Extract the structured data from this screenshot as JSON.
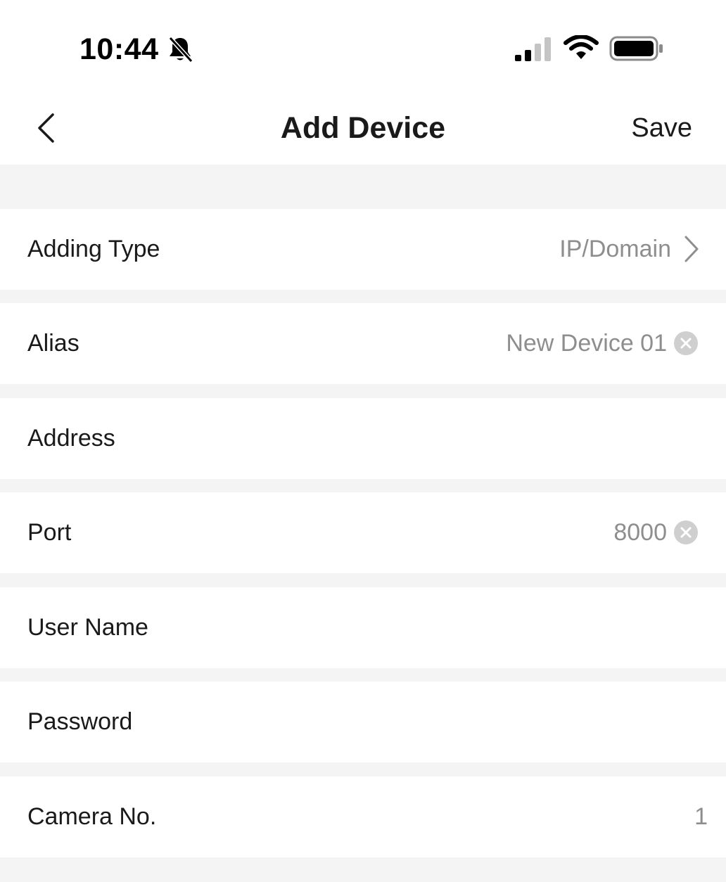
{
  "status_bar": {
    "time": "10:44",
    "icons": [
      "bell-slash-icon",
      "cellular-signal-icon",
      "wifi-icon",
      "battery-icon"
    ]
  },
  "nav": {
    "title": "Add Device",
    "save_label": "Save",
    "back_icon": "chevron-left-icon"
  },
  "form": {
    "adding_type": {
      "label": "Adding Type",
      "value": "IP/Domain"
    },
    "alias": {
      "label": "Alias",
      "value": "New Device 01"
    },
    "address": {
      "label": "Address",
      "value": ""
    },
    "port": {
      "label": "Port",
      "value": "8000"
    },
    "user_name": {
      "label": "User Name",
      "value": ""
    },
    "password": {
      "label": "Password",
      "value": ""
    },
    "camera_no": {
      "label": "Camera No.",
      "value": "1"
    }
  },
  "colors": {
    "background": "#f4f4f4",
    "row_background": "#ffffff",
    "label_text": "#1a1a1a",
    "value_text": "#8e8e8e",
    "clear_button": "#cfcfcf"
  }
}
